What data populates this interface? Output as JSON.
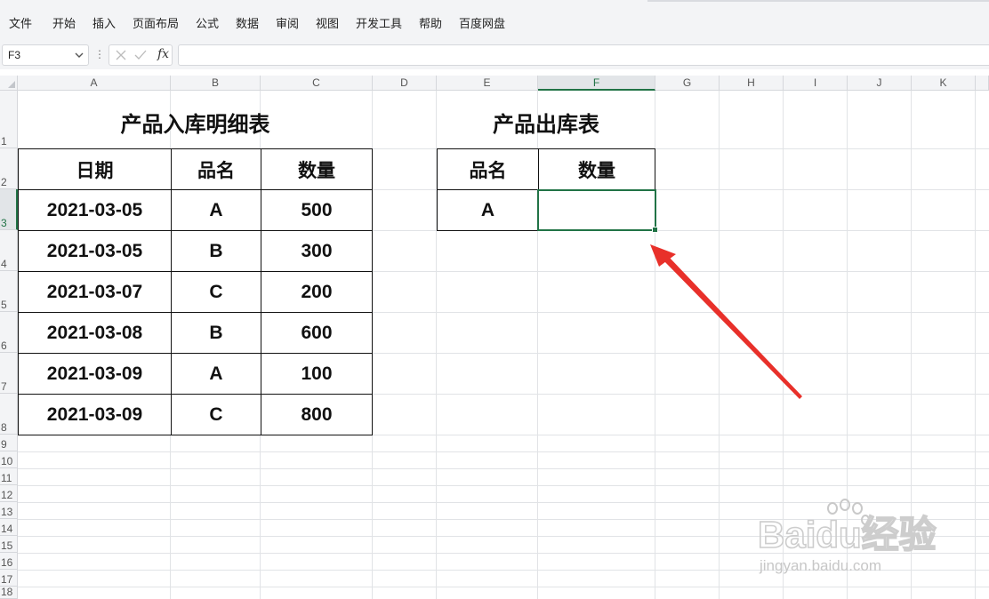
{
  "menu": [
    "文件",
    "开始",
    "插入",
    "页面布局",
    "公式",
    "数据",
    "审阅",
    "视图",
    "开发工具",
    "帮助",
    "百度网盘"
  ],
  "formula_bar": {
    "name_box": "F3",
    "fx_label": "fx",
    "formula": ""
  },
  "columns": [
    "A",
    "B",
    "C",
    "D",
    "E",
    "F",
    "G",
    "H",
    "I",
    "J",
    "K"
  ],
  "rows": [
    "1",
    "2",
    "3",
    "4",
    "5",
    "6",
    "7",
    "8",
    "9",
    "10",
    "11",
    "12",
    "13",
    "14",
    "15",
    "16",
    "17",
    "18"
  ],
  "selected_cell": {
    "column": "F",
    "row": "3"
  },
  "inbound_table": {
    "title": "产品入库明细表",
    "headers": [
      "日期",
      "品名",
      "数量"
    ],
    "rows": [
      [
        "2021-03-05",
        "A",
        "500"
      ],
      [
        "2021-03-05",
        "B",
        "300"
      ],
      [
        "2021-03-07",
        "C",
        "200"
      ],
      [
        "2021-03-08",
        "B",
        "600"
      ],
      [
        "2021-03-09",
        "A",
        "100"
      ],
      [
        "2021-03-09",
        "C",
        "800"
      ]
    ]
  },
  "outbound_table": {
    "title": "产品出库表",
    "headers": [
      "品名",
      "数量"
    ],
    "rows": [
      [
        "A",
        ""
      ]
    ]
  },
  "annotation": {
    "arrow_color": "#e8302a"
  },
  "watermark": {
    "brand": "Baidu经验",
    "url": "jingyan.baidu.com"
  },
  "colors": {
    "accent": "#217346",
    "border": "#111111",
    "gridline": "#e1e3e6"
  }
}
